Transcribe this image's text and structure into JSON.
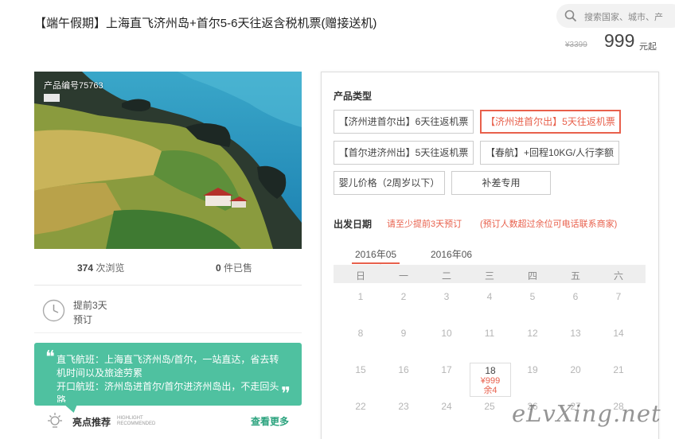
{
  "header": {
    "title": "【端午假期】上海直飞济州岛+首尔5-6天往返含税机票(赠接送机)",
    "search_placeholder": "搜索国家、城市、产",
    "original_price": "¥3399",
    "price": "999",
    "price_unit": "元起"
  },
  "gallery": {
    "product_no": "产品编号75763"
  },
  "stats": {
    "views_count": "374",
    "views_label": " 次浏览",
    "sold_count": "0",
    "sold_label": " 件已售"
  },
  "booking": {
    "advance_line1": "提前3天",
    "advance_line2": "预订"
  },
  "highlight": {
    "open_quote": "❝",
    "close_quote": "❞",
    "text": "直飞航班：上海直飞济州岛/首尔，一站直达，省去转机时间以及旅途劳累\n开口航班：济州岛进首尔/首尔进济州岛出，不走回头路",
    "label": "亮点推荐",
    "sub_label": "HIGHLIGHT RECOMMENDED",
    "more": "查看更多"
  },
  "panel": {
    "product_type_label": "产品类型",
    "options": [
      {
        "label": "【济州进首尔出】6天往返机票",
        "selected": false
      },
      {
        "label": "【济州进首尔出】5天往返机票",
        "selected": true
      },
      {
        "label": "【首尔进济州出】5天往返机票",
        "selected": false
      },
      {
        "label": "【春航】+回程10KG/人行李额",
        "selected": false
      },
      {
        "label": "婴儿价格（2周岁以下）",
        "selected": false
      },
      {
        "label": "补差专用",
        "selected": false
      }
    ],
    "date_label": "出发日期",
    "note1": "请至少提前3天预订",
    "note2": "(预订人数超过余位可电话联系商家)",
    "months": [
      "2016年05",
      "2016年06"
    ],
    "weekdays": [
      "日",
      "一",
      "二",
      "三",
      "四",
      "五",
      "六"
    ],
    "days": [
      "1",
      "2",
      "3",
      "4",
      "5",
      "6",
      "7",
      "8",
      "9",
      "10",
      "11",
      "12",
      "13",
      "14",
      "15",
      "16",
      "17",
      "18",
      "19",
      "20",
      "21",
      "22",
      "23",
      "24",
      "25",
      "26",
      "27",
      "28"
    ],
    "active_day": {
      "day": "18",
      "price": "¥999",
      "remaining": "余4"
    }
  },
  "watermark": "eLvXing.net",
  "colors": {
    "accent": "#e8604c",
    "highlight_bg": "#4fc1a0",
    "more_link": "#2ba37e"
  }
}
